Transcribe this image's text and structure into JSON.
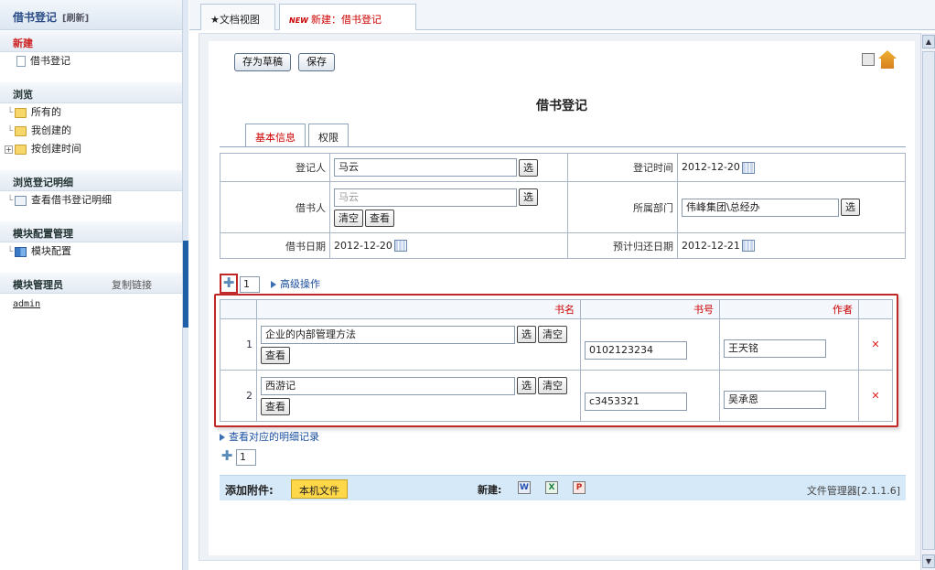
{
  "sidebar": {
    "title": "借书登记",
    "refresh": "[刷新]",
    "new_section": "新建",
    "new_item": "借书登记",
    "browse_section": "浏览",
    "browse_items": [
      "所有的",
      "我创建的",
      "按创建时间"
    ],
    "detail_section": "浏览登记明细",
    "detail_item": "查看借书登记明细",
    "module_section": "模块配置管理",
    "module_item": "模块配置",
    "admin_section": "模块管理员",
    "copy_link": "复制链接",
    "admin_user": "admin"
  },
  "tabs": {
    "doc_view": "★文档视图",
    "new_badge": "NEW",
    "new_doc": "新建：借书登记"
  },
  "toolbar": {
    "draft": "存为草稿",
    "save": "保存"
  },
  "form": {
    "title": "借书登记",
    "tab_basic": "基本信息",
    "tab_perm": "权限",
    "registrant_label": "登记人",
    "registrant_value": "马云",
    "reg_time_label": "登记时间",
    "reg_time_value": "2012-12-20",
    "borrower_label": "借书人",
    "borrower_placeholder": "马云",
    "dept_label": "所属部门",
    "dept_value": "伟峰集团\\总经办",
    "borrow_date_label": "借书日期",
    "borrow_date_value": "2012-12-20",
    "return_date_label": "预计归还日期",
    "return_date_value": "2012-12-21",
    "select": "选",
    "clear": "清空",
    "view": "查看"
  },
  "detail": {
    "row_count": "1",
    "advanced": "高级操作",
    "headers": [
      "书名",
      "书号",
      "作者"
    ],
    "rows": [
      {
        "idx": "1",
        "title": "企业的内部管理方法",
        "isbn": "0102123234",
        "author": "王天铭"
      },
      {
        "idx": "2",
        "title": "西游记",
        "isbn": "c3453321",
        "author": "吴承恩"
      }
    ],
    "view_records": "查看对应的明细记录",
    "row_count2": "1"
  },
  "attach": {
    "label": "添加附件:",
    "local": "本机文件",
    "new_label": "新建:",
    "version": "文件管理器[2.1.1.6]"
  }
}
